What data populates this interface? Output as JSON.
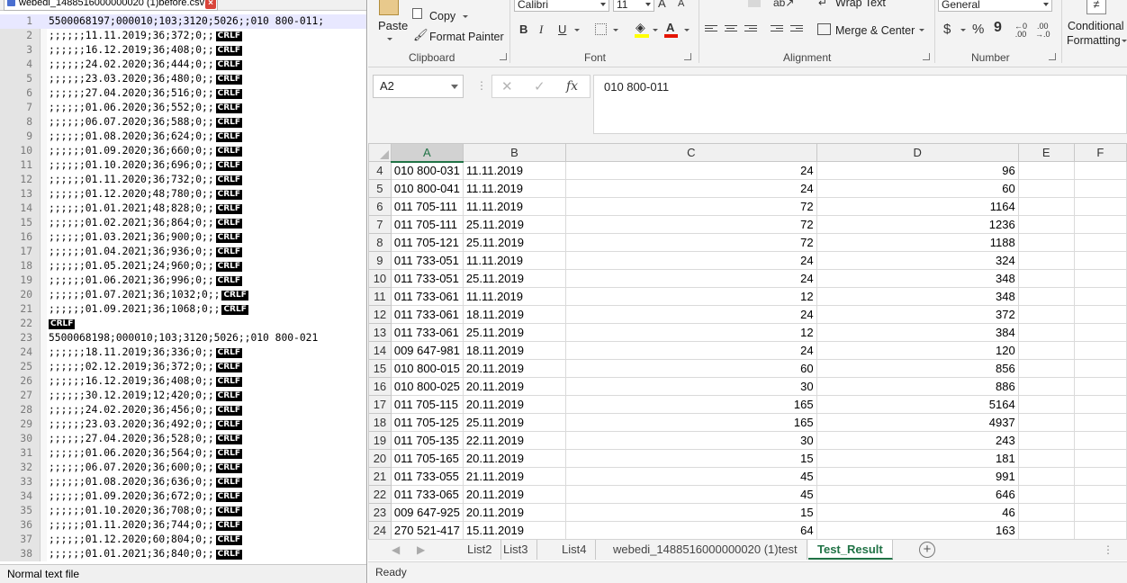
{
  "notepad": {
    "tab_title": "webedi_1488516000000020 (1)before.csv",
    "crlf_label": "CRLF",
    "lines": [
      {
        "n": "1",
        "text": "5500068197;000010;103;3120;5026;;010 800-011;",
        "crlf": false
      },
      {
        "n": "2",
        "text": ";;;;;;11.11.2019;36;372;0;;",
        "crlf": true
      },
      {
        "n": "3",
        "text": ";;;;;;16.12.2019;36;408;0;;",
        "crlf": true
      },
      {
        "n": "4",
        "text": ";;;;;;24.02.2020;36;444;0;;",
        "crlf": true
      },
      {
        "n": "5",
        "text": ";;;;;;23.03.2020;36;480;0;;",
        "crlf": true
      },
      {
        "n": "6",
        "text": ";;;;;;27.04.2020;36;516;0;;",
        "crlf": true
      },
      {
        "n": "7",
        "text": ";;;;;;01.06.2020;36;552;0;;",
        "crlf": true
      },
      {
        "n": "8",
        "text": ";;;;;;06.07.2020;36;588;0;;",
        "crlf": true
      },
      {
        "n": "9",
        "text": ";;;;;;01.08.2020;36;624;0;;",
        "crlf": true
      },
      {
        "n": "10",
        "text": ";;;;;;01.09.2020;36;660;0;;",
        "crlf": true
      },
      {
        "n": "11",
        "text": ";;;;;;01.10.2020;36;696;0;;",
        "crlf": true
      },
      {
        "n": "12",
        "text": ";;;;;;01.11.2020;36;732;0;;",
        "crlf": true
      },
      {
        "n": "13",
        "text": ";;;;;;01.12.2020;48;780;0;;",
        "crlf": true
      },
      {
        "n": "14",
        "text": ";;;;;;01.01.2021;48;828;0;;",
        "crlf": true
      },
      {
        "n": "15",
        "text": ";;;;;;01.02.2021;36;864;0;;",
        "crlf": true
      },
      {
        "n": "16",
        "text": ";;;;;;01.03.2021;36;900;0;;",
        "crlf": true
      },
      {
        "n": "17",
        "text": ";;;;;;01.04.2021;36;936;0;;",
        "crlf": true
      },
      {
        "n": "18",
        "text": ";;;;;;01.05.2021;24;960;0;;",
        "crlf": true
      },
      {
        "n": "19",
        "text": ";;;;;;01.06.2021;36;996;0;;",
        "crlf": true
      },
      {
        "n": "20",
        "text": ";;;;;;01.07.2021;36;1032;0;;",
        "crlf": true
      },
      {
        "n": "21",
        "text": ";;;;;;01.09.2021;36;1068;0;;",
        "crlf": true
      },
      {
        "n": "22",
        "text": "",
        "crlf": true
      },
      {
        "n": "23",
        "text": "5500068198;000010;103;3120;5026;;010 800-021",
        "crlf": false
      },
      {
        "n": "24",
        "text": ";;;;;;18.11.2019;36;336;0;;",
        "crlf": true
      },
      {
        "n": "25",
        "text": ";;;;;;02.12.2019;36;372;0;;",
        "crlf": true
      },
      {
        "n": "26",
        "text": ";;;;;;16.12.2019;36;408;0;;",
        "crlf": true
      },
      {
        "n": "27",
        "text": ";;;;;;30.12.2019;12;420;0;;",
        "crlf": true
      },
      {
        "n": "28",
        "text": ";;;;;;24.02.2020;36;456;0;;",
        "crlf": true
      },
      {
        "n": "29",
        "text": ";;;;;;23.03.2020;36;492;0;;",
        "crlf": true
      },
      {
        "n": "30",
        "text": ";;;;;;27.04.2020;36;528;0;;",
        "crlf": true
      },
      {
        "n": "31",
        "text": ";;;;;;01.06.2020;36;564;0;;",
        "crlf": true
      },
      {
        "n": "32",
        "text": ";;;;;;06.07.2020;36;600;0;;",
        "crlf": true
      },
      {
        "n": "33",
        "text": ";;;;;;01.08.2020;36;636;0;;",
        "crlf": true
      },
      {
        "n": "34",
        "text": ";;;;;;01.09.2020;36;672;0;;",
        "crlf": true
      },
      {
        "n": "35",
        "text": ";;;;;;01.10.2020;36;708;0;;",
        "crlf": true
      },
      {
        "n": "36",
        "text": ";;;;;;01.11.2020;36;744;0;;",
        "crlf": true
      },
      {
        "n": "37",
        "text": ";;;;;;01.12.2020;60;804;0;;",
        "crlf": true
      },
      {
        "n": "38",
        "text": ";;;;;;01.01.2021;36;840;0;;",
        "crlf": true
      }
    ],
    "status": "Normal text file"
  },
  "excel": {
    "ribbon": {
      "paste_label": "Paste",
      "copy_label": "Copy",
      "format_painter_label": "Format Painter",
      "clipboard_group": "Clipboard",
      "font_name": "Calibri",
      "font_size": "11",
      "bold": "B",
      "italic": "I",
      "underline": "U",
      "font_group": "Font",
      "wrap_text_label": "Wrap Text",
      "merge_center_label": "Merge & Center",
      "alignment_group": "Alignment",
      "number_format": "General",
      "currency_symbol": "$",
      "percent_symbol": "%",
      "comma_symbol": "9",
      "number_group": "Number",
      "conditional_label_1": "Conditional",
      "conditional_label_2": "Formatting"
    },
    "formula_bar": {
      "name_box": "A2",
      "fx_label": "fx",
      "value": "010 800-011"
    },
    "columns": [
      "A",
      "B",
      "C",
      "D",
      "E",
      "F"
    ],
    "selected_column": "A",
    "rows": [
      {
        "r": "4",
        "a": "010 800-031",
        "b": "11.11.2019",
        "c": "24",
        "d": "96"
      },
      {
        "r": "5",
        "a": "010 800-041",
        "b": "11.11.2019",
        "c": "24",
        "d": "60"
      },
      {
        "r": "6",
        "a": "011 705-111",
        "b": "11.11.2019",
        "c": "72",
        "d": "1164"
      },
      {
        "r": "7",
        "a": "011 705-111",
        "b": "25.11.2019",
        "c": "72",
        "d": "1236"
      },
      {
        "r": "8",
        "a": "011 705-121",
        "b": "25.11.2019",
        "c": "72",
        "d": "1188"
      },
      {
        "r": "9",
        "a": "011 733-051",
        "b": "11.11.2019",
        "c": "24",
        "d": "324"
      },
      {
        "r": "10",
        "a": "011 733-051",
        "b": "25.11.2019",
        "c": "24",
        "d": "348"
      },
      {
        "r": "11",
        "a": "011 733-061",
        "b": "11.11.2019",
        "c": "12",
        "d": "348"
      },
      {
        "r": "12",
        "a": "011 733-061",
        "b": "18.11.2019",
        "c": "24",
        "d": "372"
      },
      {
        "r": "13",
        "a": "011 733-061",
        "b": "25.11.2019",
        "c": "12",
        "d": "384"
      },
      {
        "r": "14",
        "a": "009 647-981",
        "b": "18.11.2019",
        "c": "24",
        "d": "120"
      },
      {
        "r": "15",
        "a": "010 800-015",
        "b": "20.11.2019",
        "c": "60",
        "d": "856"
      },
      {
        "r": "16",
        "a": "010 800-025",
        "b": "20.11.2019",
        "c": "30",
        "d": "886"
      },
      {
        "r": "17",
        "a": "011 705-115",
        "b": "20.11.2019",
        "c": "165",
        "d": "5164"
      },
      {
        "r": "18",
        "a": "011 705-125",
        "b": "25.11.2019",
        "c": "165",
        "d": "4937"
      },
      {
        "r": "19",
        "a": "011 705-135",
        "b": "22.11.2019",
        "c": "30",
        "d": "243"
      },
      {
        "r": "20",
        "a": "011 705-165",
        "b": "20.11.2019",
        "c": "15",
        "d": "181"
      },
      {
        "r": "21",
        "a": "011 733-055",
        "b": "21.11.2019",
        "c": "45",
        "d": "991"
      },
      {
        "r": "22",
        "a": "011 733-065",
        "b": "20.11.2019",
        "c": "45",
        "d": "646"
      },
      {
        "r": "23",
        "a": "009 647-925",
        "b": "20.11.2019",
        "c": "15",
        "d": "46"
      },
      {
        "r": "24",
        "a": "270 521-417",
        "b": "15.11.2019",
        "c": "64",
        "d": "163"
      }
    ],
    "sheet_tabs": [
      "List2",
      "List3",
      "List4",
      "webedi_1488516000000020 (1)test",
      "Test_Result"
    ],
    "active_sheet": "Test_Result",
    "status": "Ready"
  }
}
